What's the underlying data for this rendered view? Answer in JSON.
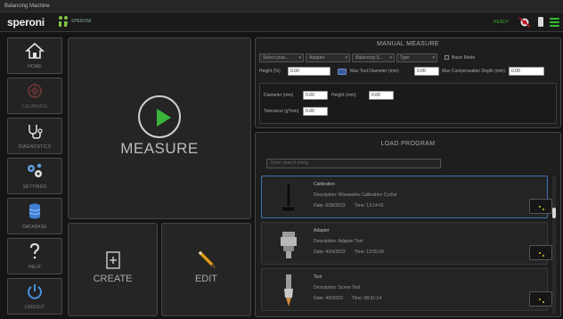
{
  "window": {
    "title": "Balancing Machine"
  },
  "header": {
    "logo_text": "speroni",
    "logo_sub": "SPERONI",
    "status_text": "READY",
    "colors": {
      "status": "#36a536",
      "accent": "#39b639"
    }
  },
  "nav": [
    {
      "label": "HOME",
      "icon": "home-icon",
      "enabled": true
    },
    {
      "label": "CALIBRATE",
      "icon": "target-icon",
      "enabled": false
    },
    {
      "label": "DIAGNOSTICS",
      "icon": "stethoscope-icon",
      "enabled": true
    },
    {
      "label": "SETTINGS",
      "icon": "gears-icon",
      "enabled": true
    },
    {
      "label": "DATABASE",
      "icon": "database-icon",
      "enabled": true
    },
    {
      "label": "HELP",
      "icon": "question-icon",
      "enabled": true
    },
    {
      "label": "LOGOUT",
      "icon": "power-icon",
      "enabled": true
    }
  ],
  "tiles": {
    "measure": "MEASURE",
    "create": "CREATE",
    "edit": "EDIT"
  },
  "manual_measure": {
    "title": "MANUAL MEASURE",
    "selects": [
      "Select your...",
      "Adapter",
      "Balancing S...",
      "Type"
    ],
    "basic_mode_label": "Basic Mode",
    "height_label": "Height (%)",
    "height_value": "0.00",
    "max_tool_diameter_label": "Max Tool Diameter (mm)",
    "max_tool_diameter_value": "0.00",
    "max_comp_depth_label": "Max Compensation Depth (mm)",
    "max_comp_depth_value": "0.00",
    "diameter_label": "Diameter (mm)",
    "diameter_value": "0.00",
    "sub_height_label": "Height (mm)",
    "sub_height_value": "0.00",
    "tolerance_label": "Tolerance (g*mm)",
    "tolerance_value": "0.00"
  },
  "load_program": {
    "title": "LOAD PROGRAM",
    "search_placeholder": "Enter search string",
    "items": [
      {
        "name": "Calibration",
        "description": "Description:  Wiseworks Calibration Cyclist",
        "date": "Date:   6/28/2023",
        "time": "Time:   13:14:41",
        "thumb": "calibration-bar-icon"
      },
      {
        "name": "Adapter",
        "description": "Description:  Adapter Tool",
        "date": "Date:   4/24/2023",
        "time": "Time:   13:55:09",
        "thumb": "adapter-tool-icon"
      },
      {
        "name": "Tool",
        "description": "Description:  Screw Tool",
        "date": "Date:   4/6/2023",
        "time": "Time:   08:31:14",
        "thumb": "screw-tool-icon"
      }
    ]
  }
}
